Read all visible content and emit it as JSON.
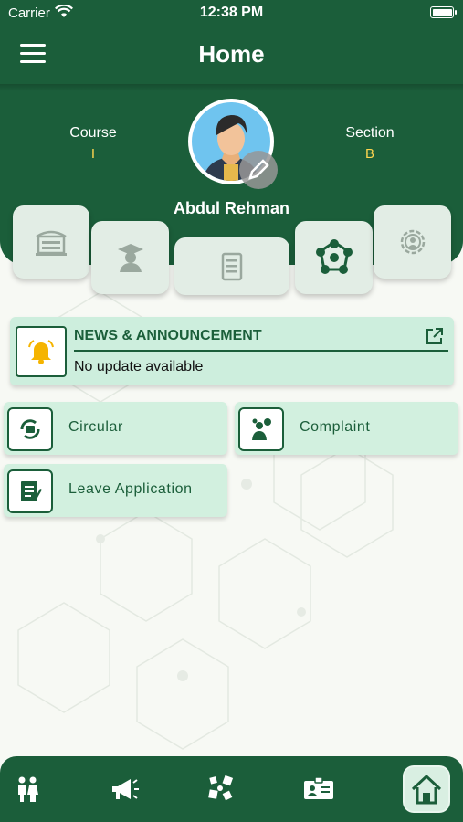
{
  "status_bar": {
    "carrier": "Carrier",
    "time": "12:38 PM"
  },
  "header": {
    "title": "Home",
    "menu_icon": "hamburger-menu-icon"
  },
  "profile": {
    "course_label": "Course",
    "course_value": "I",
    "section_label": "Section",
    "section_value": "B",
    "name": "Abdul Rehman",
    "avatar_icon": "student-avatar-icon",
    "edit_icon": "pencil-icon"
  },
  "feature_tiles": [
    {
      "icon": "school-building-icon"
    },
    {
      "icon": "graduate-icon"
    },
    {
      "icon": "timetable-icon"
    },
    {
      "icon": "group-network-icon"
    },
    {
      "icon": "settings-gear-icon"
    }
  ],
  "news": {
    "title": "NEWS & ANNOUNCEMENT",
    "text": "No update available",
    "bell_icon": "bell-icon",
    "link_icon": "external-link-icon"
  },
  "quick_actions": [
    {
      "label": "Circular",
      "icon": "circular-icon"
    },
    {
      "label": "Complaint",
      "icon": "complaint-icon"
    },
    {
      "label": "Leave Application",
      "icon": "leave-application-icon"
    }
  ],
  "bottom_nav": [
    {
      "icon": "students-icon"
    },
    {
      "icon": "megaphone-icon"
    },
    {
      "icon": "activities-icon"
    },
    {
      "icon": "id-card-icon"
    },
    {
      "icon": "home-icon",
      "active": true
    }
  ],
  "colors": {
    "primary": "#1b5e3a",
    "accent": "#ffd54f",
    "tile": "#e2ede5",
    "card": "#d2f0df"
  }
}
